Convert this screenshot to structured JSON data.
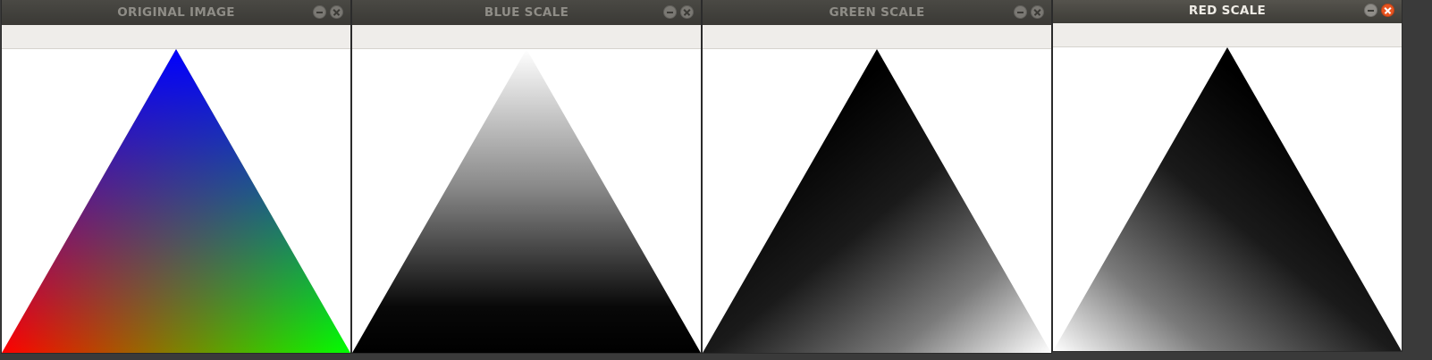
{
  "windows": [
    {
      "title": "ORIGINAL IMAGE",
      "active": false
    },
    {
      "title": "BLUE SCALE",
      "active": false
    },
    {
      "title": "GREEN SCALE",
      "active": false
    },
    {
      "title": "RED SCALE",
      "active": true
    }
  ],
  "icons": {
    "minimize": "minimize-icon",
    "close": "close-icon"
  },
  "colors": {
    "titlebar": "#3c3b37",
    "inactive_title": "#8f8d87",
    "active_title": "#efece6",
    "close_active": "#e95420",
    "toolbar": "#efedea",
    "vertex_top": "#0000ff",
    "vertex_left": "#ff0000",
    "vertex_right": "#00ff00"
  }
}
